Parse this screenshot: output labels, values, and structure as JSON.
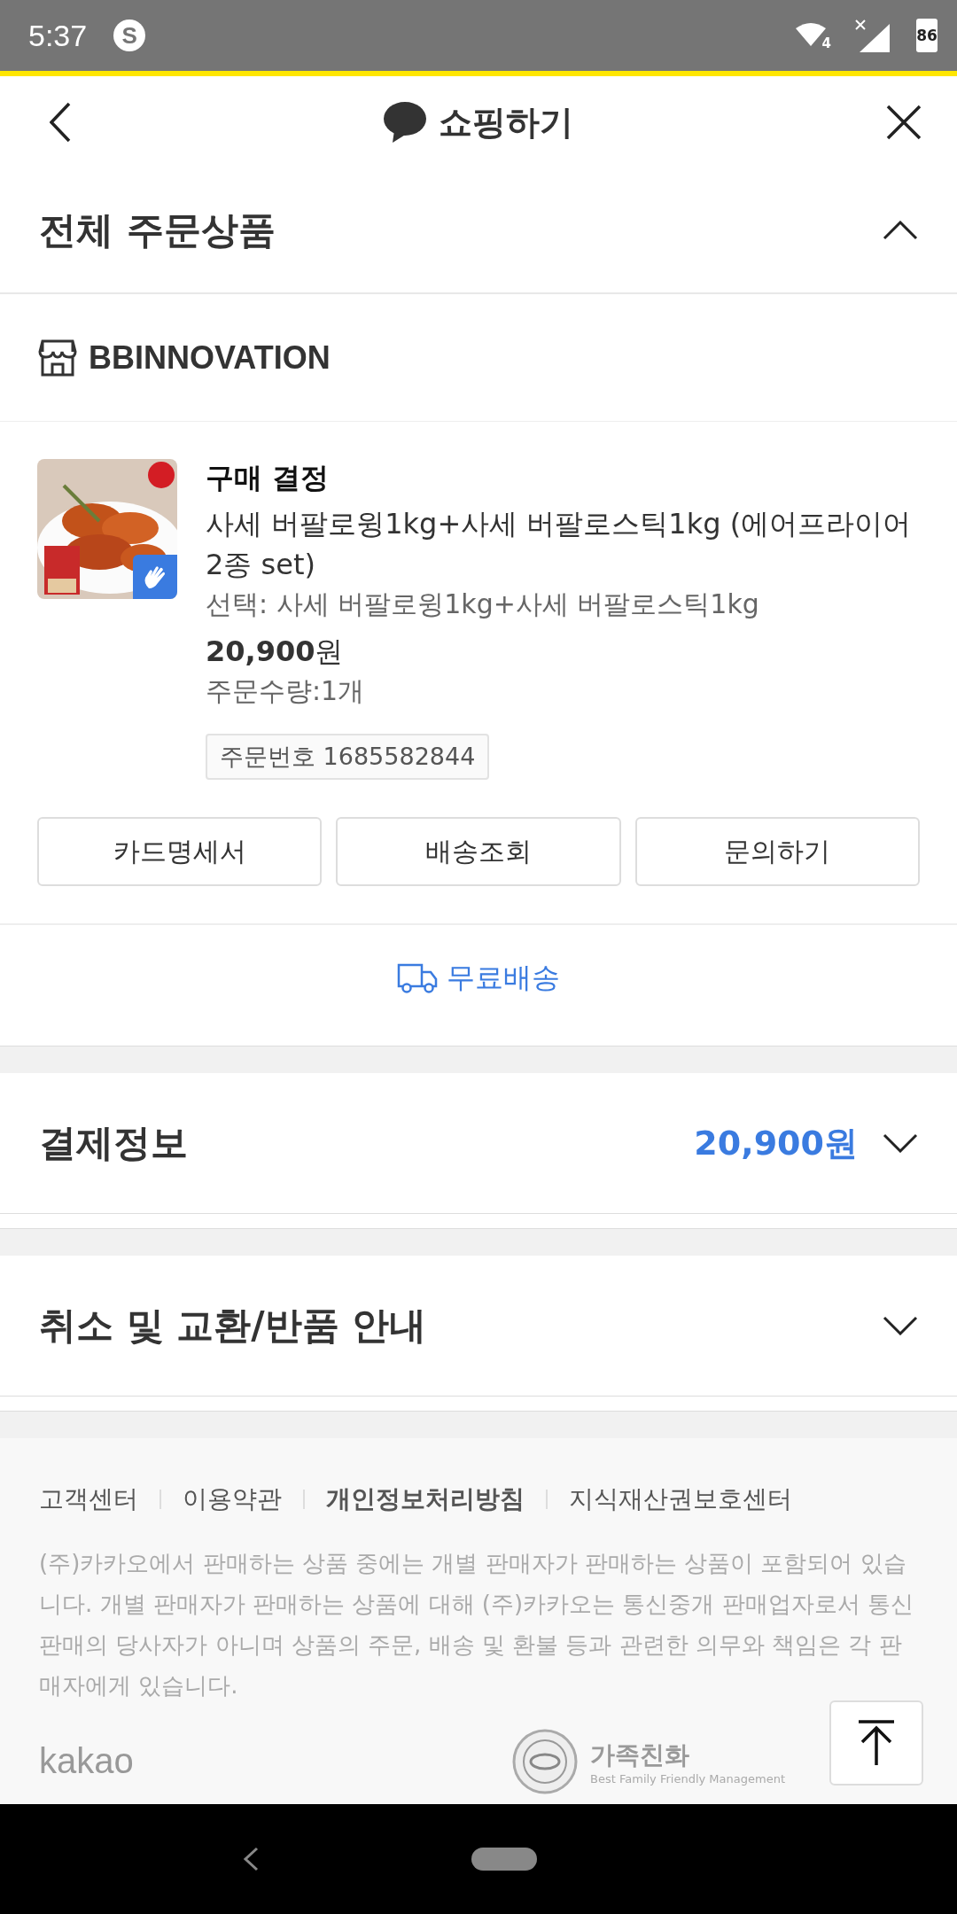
{
  "status_bar": {
    "time": "5:37",
    "app_icon": "S",
    "network": "4",
    "battery": "86"
  },
  "header": {
    "title": "쇼핑하기"
  },
  "order_section": {
    "title": "전체 주문상품",
    "expanded": true
  },
  "store": {
    "name": "BBINNOVATION"
  },
  "product": {
    "status": "구매 결정",
    "name": "사세 버팔로윙1kg+사세 버팔로스틱1kg (에어프라이어 2종 set)",
    "option": "선택: 사세 버팔로윙1kg+사세 버팔로스틱1kg",
    "price": "**20,900**원",
    "quantity": "주문수량:1개",
    "order_number": "주문번호 1685582844"
  },
  "buttons": [
    "카드명세서",
    "배송조회",
    "문의하기"
  ],
  "shipping": {
    "label": "무료배송"
  },
  "payment": {
    "title": "결제정보",
    "amount": "20,900원",
    "expanded": false
  },
  "refund": {
    "title": "취소 및 교환/반품 안내",
    "expanded": false
  },
  "footer": {
    "links": [
      {
        "label": "고객센터",
        "bold": false
      },
      {
        "label": "이용약관",
        "bold": false
      },
      {
        "label": "개인정보처리방침",
        "bold": true
      },
      {
        "label": "지식재산권보호센터",
        "bold": false
      }
    ],
    "notice": "(주)카카오에서 판매하는 상품 중에는 개별 판매자가 판매하는 상품이 포함되어 있습니다. 개별 판매자가 판매하는 상품에 대해 (주)카카오는 통신중개 판매업자로서 통신판매의 당사자가 아니며 상품의 주문, 배송 및 환불 등과 관련한 의무와 책임은 각 판매자에게 있습니다.",
    "logo": "kakao",
    "badge_title": "가족친화",
    "badge_subtitle": "Best Family Friendly Management"
  }
}
